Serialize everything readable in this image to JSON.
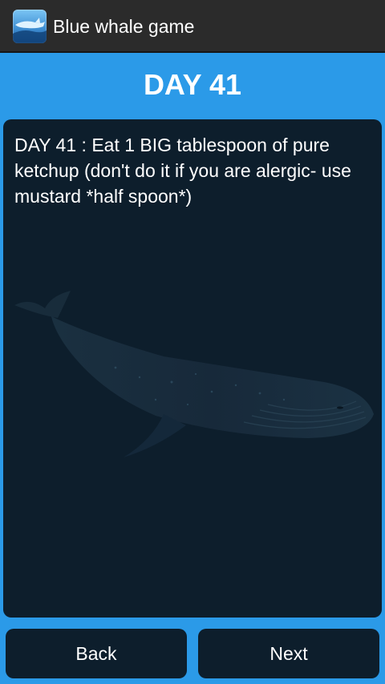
{
  "app": {
    "title": "Blue whale game",
    "icon": "whale-app-icon"
  },
  "heading": "DAY 41",
  "task": "DAY 41 : Eat 1 BIG tablespoon of pure ketchup (don't do it if you are alergic- use mustard *half spoon*)",
  "buttons": {
    "back": "Back",
    "next": "Next"
  },
  "colors": {
    "background": "#2b9ae8",
    "action_bar": "#2b2b2b",
    "card": "#0d1e2c",
    "text": "#ffffff"
  }
}
